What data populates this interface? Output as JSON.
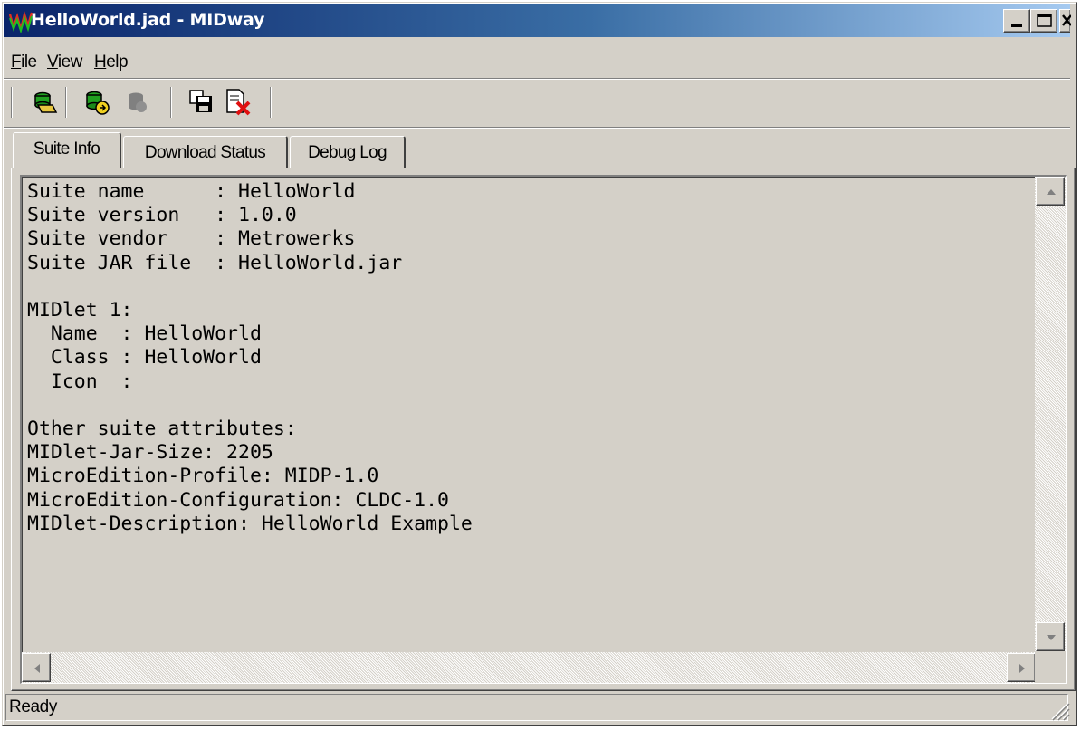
{
  "window": {
    "title": "HelloWorld.jad - MIDway"
  },
  "menu": {
    "file": {
      "pre": "",
      "ul": "F",
      "post": "ile"
    },
    "view": {
      "pre": "",
      "ul": "V",
      "post": "iew"
    },
    "help": {
      "pre": "",
      "ul": "H",
      "post": "elp"
    }
  },
  "toolbar": {
    "icons": [
      "open-icon",
      "run-icon",
      "stop-icon",
      "save-icon",
      "close-file-icon"
    ]
  },
  "tabs": {
    "suite_info": "Suite Info",
    "download_status": "Download Status",
    "debug_log": "Debug Log",
    "active": "Suite Info"
  },
  "content": {
    "lines": [
      "Suite name      : HelloWorld",
      "Suite version   : 1.0.0",
      "Suite vendor    : Metrowerks",
      "Suite JAR file  : HelloWorld.jar",
      "",
      "MIDlet 1:",
      "  Name  : HelloWorld",
      "  Class : HelloWorld",
      "  Icon  :",
      "",
      "Other suite attributes:",
      "MIDlet-Jar-Size: 2205",
      "MicroEdition-Profile: MIDP-1.0",
      "MicroEdition-Configuration: CLDC-1.0",
      "MIDlet-Description: HelloWorld Example"
    ]
  },
  "status": {
    "text": "Ready"
  },
  "colors": {
    "title_start": "#0a246a",
    "title_end": "#a6caf0",
    "face": "#d4d0c8"
  }
}
